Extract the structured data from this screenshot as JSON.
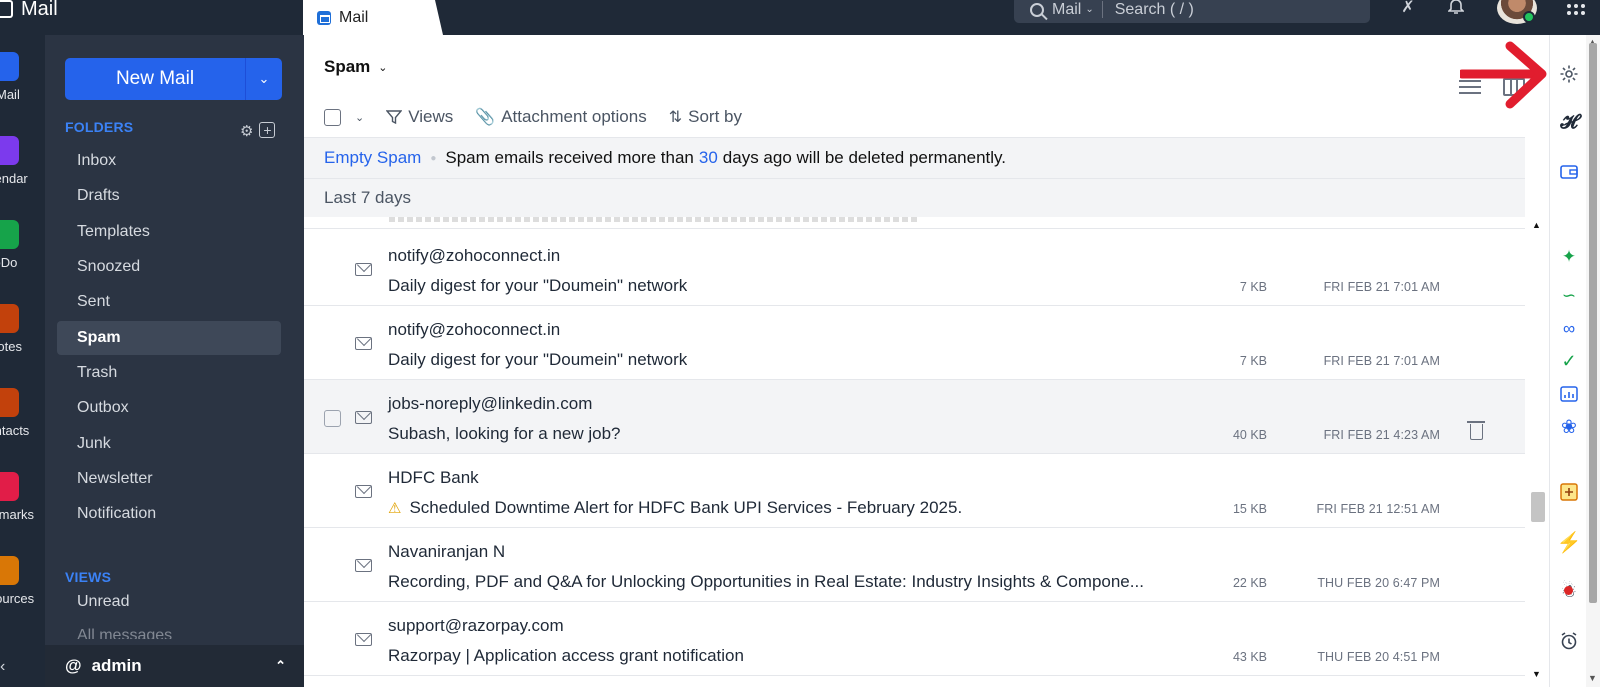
{
  "top_bar": {
    "app_name": "Mail",
    "tab_label": "Mail",
    "search_scope": "Mail",
    "search_placeholder": "Search ( / )"
  },
  "app_rail": [
    {
      "label": "Mail",
      "icon": "mail-icon",
      "color": "#2563eb"
    },
    {
      "label": "Calendar",
      "icon": "calendar-icon",
      "color": "#7c3aed"
    },
    {
      "label": "ToDo",
      "icon": "todo-check-icon",
      "color": "#16a34a"
    },
    {
      "label": "Notes",
      "icon": "notes-icon",
      "color": "#c2410c"
    },
    {
      "label": "Contacts",
      "icon": "contacts-icon",
      "color": "#c2410c"
    },
    {
      "label": "Bookmarks",
      "icon": "bookmark-icon",
      "color": "#e11d48"
    },
    {
      "label": "Resources",
      "icon": "resources-icon",
      "color": "#d97706"
    }
  ],
  "sidebar": {
    "new_mail": "New Mail",
    "folders_title": "FOLDERS",
    "folders": [
      "Inbox",
      "Drafts",
      "Templates",
      "Snoozed",
      "Sent",
      "Spam",
      "Trash",
      "Outbox",
      "Junk",
      "Newsletter",
      "Notification"
    ],
    "active_folder": "Spam",
    "views_title": "VIEWS",
    "views": [
      "Unread",
      "All messages"
    ],
    "account": "admin"
  },
  "main": {
    "folder_title": "Spam",
    "toolbar": {
      "views": "Views",
      "attachment_options": "Attachment options",
      "sort_by": "Sort by"
    },
    "banner": {
      "empty_spam": "Empty Spam",
      "text_before": "Spam emails received more than",
      "days": "30",
      "text_after": "days ago will be deleted permanently."
    },
    "group_label": "Last 7 days",
    "emails": [
      {
        "sender": "notify@zohoconnect.in",
        "subject": "Daily digest for your \"Doumein\" network",
        "size": "7 KB",
        "date": "FRI FEB 21 7:01 AM"
      },
      {
        "sender": "notify@zohoconnect.in",
        "subject": "Daily digest for your \"Doumein\" network",
        "size": "7 KB",
        "date": "FRI FEB 21 7:01 AM"
      },
      {
        "sender": "jobs-noreply@linkedin.com",
        "subject": "Subash, looking for a new job?",
        "size": "40 KB",
        "date": "FRI FEB 21 4:23 AM"
      },
      {
        "sender": "HDFC Bank",
        "subject": "Scheduled Downtime Alert for HDFC Bank UPI Services - February 2025.",
        "size": "15 KB",
        "date": "FRI FEB 21 12:51 AM"
      },
      {
        "sender": "Navaniranjan N",
        "subject": "Recording, PDF and Q&A for Unlocking Opportunities in Real Estate: Industry Insights & Compone...",
        "size": "22 KB",
        "date": "THU FEB 20 6:47 PM"
      },
      {
        "sender": "support@razorpay.com",
        "subject": "Razorpay | Application access grant notification",
        "size": "43 KB",
        "date": "THU FEB 20 4:51 PM"
      }
    ]
  },
  "colors": {
    "top_bar_bg": "#1f2937",
    "sidebar_bg": "#2b3443",
    "accent": "#2563eb",
    "annotation_arrow": "#e11d2e"
  }
}
